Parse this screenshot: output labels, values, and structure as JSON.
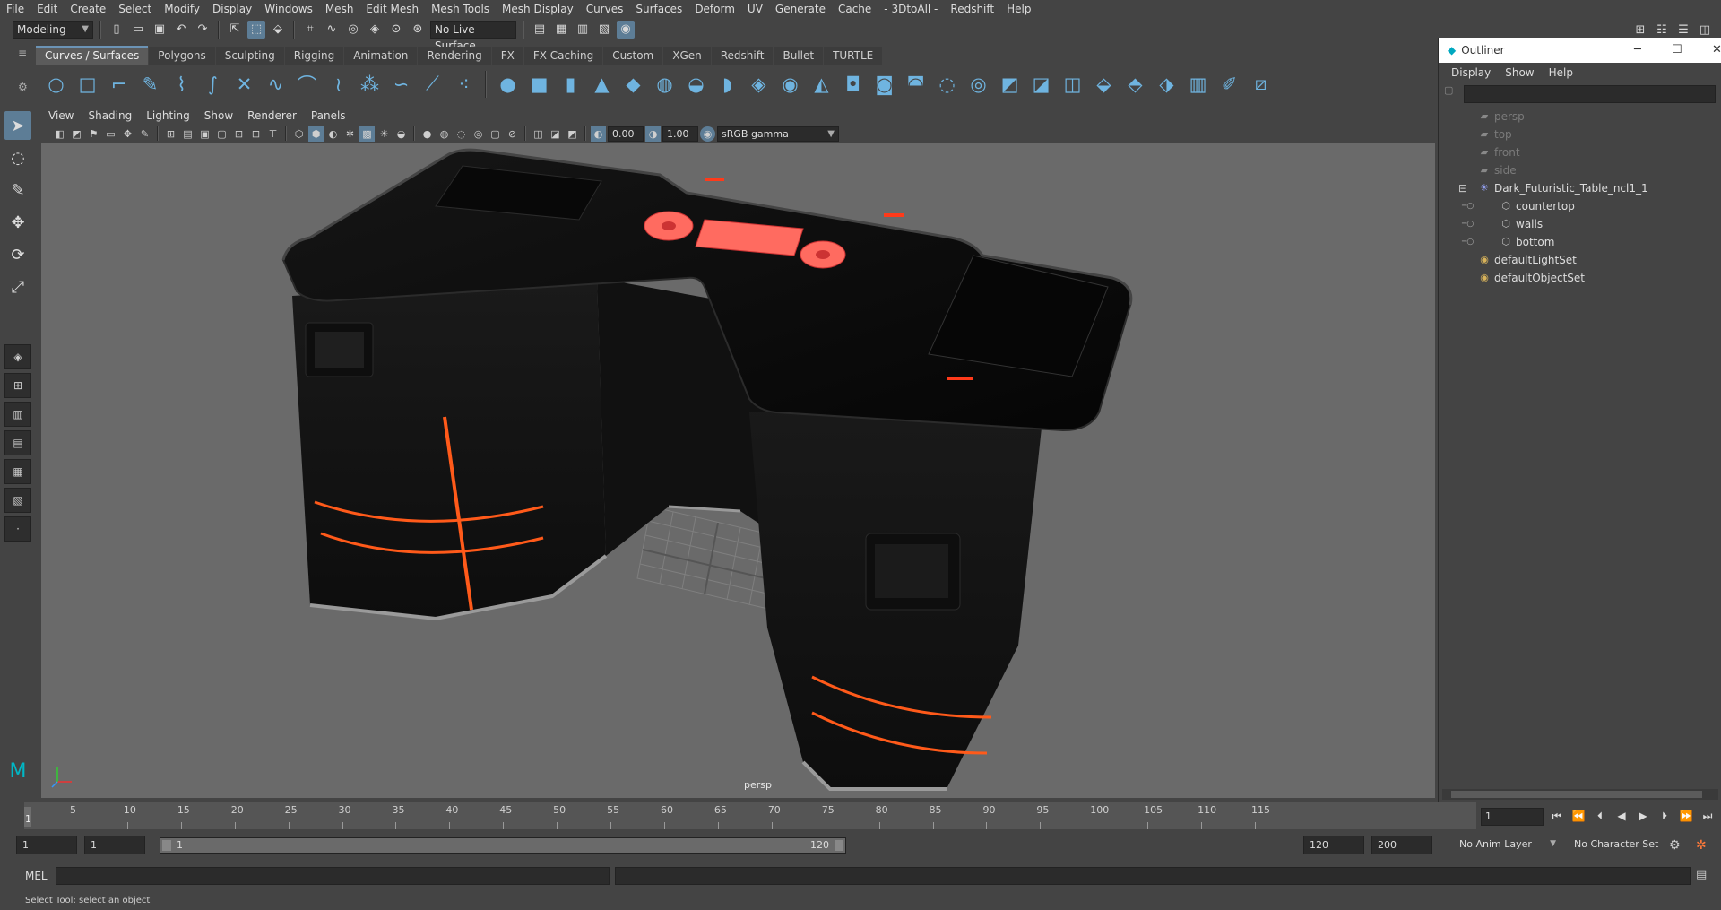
{
  "menubar": {
    "items": [
      "File",
      "Edit",
      "Create",
      "Select",
      "Modify",
      "Display",
      "Windows",
      "Mesh",
      "Edit Mesh",
      "Mesh Tools",
      "Mesh Display",
      "Curves",
      "Surfaces",
      "Deform",
      "UV",
      "Generate",
      "Cache",
      "- 3DtoAll -",
      "Redshift",
      "Help"
    ]
  },
  "statusline": {
    "mode": "Modeling",
    "live_surface": "No Live Surface"
  },
  "shelf": {
    "tabs": [
      "Curves / Surfaces",
      "Polygons",
      "Sculpting",
      "Rigging",
      "Animation",
      "Rendering",
      "FX",
      "FX Caching",
      "Custom",
      "XGen",
      "Redshift",
      "Bullet",
      "TURTLE"
    ],
    "active_tab": "Curves / Surfaces"
  },
  "viewport": {
    "menu": [
      "View",
      "Shading",
      "Lighting",
      "Show",
      "Renderer",
      "Panels"
    ],
    "exposure": "0.00",
    "gamma": "1.00",
    "color_space": "sRGB gamma",
    "camera": "persp"
  },
  "outliner": {
    "title": "Outliner",
    "menu": [
      "Display",
      "Show",
      "Help"
    ],
    "items": [
      {
        "label": "persp",
        "icon": "camera-icon",
        "dim": true,
        "indent": 0
      },
      {
        "label": "top",
        "icon": "camera-icon",
        "dim": true,
        "indent": 0
      },
      {
        "label": "front",
        "icon": "camera-icon",
        "dim": true,
        "indent": 0
      },
      {
        "label": "side",
        "icon": "camera-icon",
        "dim": true,
        "indent": 0
      },
      {
        "label": "Dark_Futuristic_Table_ncl1_1",
        "icon": "group-icon",
        "dim": false,
        "indent": 0
      },
      {
        "label": "countertop",
        "icon": "mesh-icon",
        "dim": false,
        "indent": 1
      },
      {
        "label": "walls",
        "icon": "mesh-icon",
        "dim": false,
        "indent": 1
      },
      {
        "label": "bottom",
        "icon": "mesh-icon",
        "dim": false,
        "indent": 1
      },
      {
        "label": "defaultLightSet",
        "icon": "set-icon",
        "dim": false,
        "indent": 0
      },
      {
        "label": "defaultObjectSet",
        "icon": "set-icon",
        "dim": false,
        "indent": 0
      }
    ]
  },
  "timeslider": {
    "ticks": [
      "5",
      "10",
      "15",
      "20",
      "25",
      "30",
      "35",
      "40",
      "45",
      "50",
      "55",
      "60",
      "65",
      "70",
      "75",
      "80",
      "85",
      "90",
      "95",
      "100",
      "105",
      "110",
      "115"
    ],
    "current_frame": "1",
    "frame_field": "1"
  },
  "range": {
    "start": "1",
    "playback_start": "1",
    "slider_start": "1",
    "slider_end": "120",
    "playback_end": "120",
    "end": "200",
    "anim_layer": "No Anim Layer",
    "character_set": "No Character Set"
  },
  "command": {
    "label": "MEL",
    "help": "Select Tool: select an object"
  },
  "colors": {
    "accent": "#5d7d96",
    "viewport_bg": "#6a6a6a",
    "neon": "#ff5a1a"
  }
}
